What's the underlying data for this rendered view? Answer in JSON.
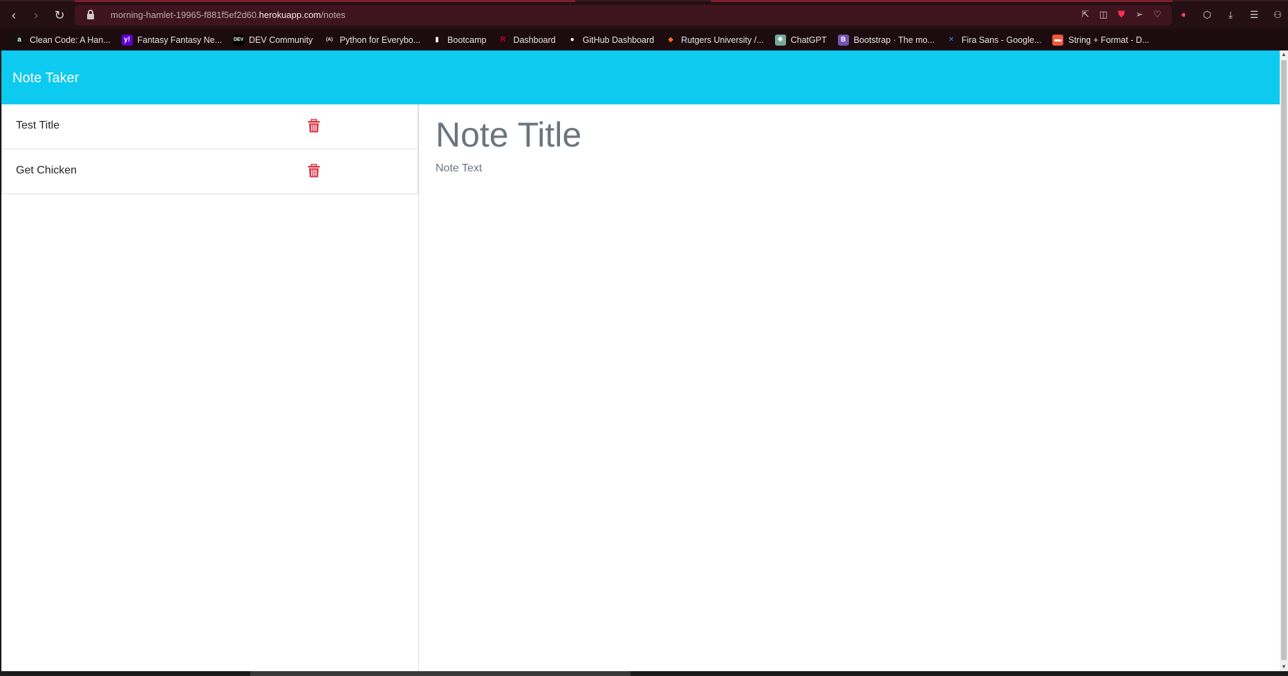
{
  "browser": {
    "url_prefix": "morning-hamlet-19965-f881f5ef2d60.",
    "url_host": "herokuapp.com",
    "url_path": "/notes",
    "nav": {
      "back": "‹",
      "forward": "›",
      "reload": "↻"
    }
  },
  "bookmarks": [
    {
      "label": "Clean Code: A Han...",
      "icon": "a",
      "icon_color": "#ffffff",
      "icon_bg": "#111111"
    },
    {
      "label": "Fantasy Fantasy Ne...",
      "icon": "y!",
      "icon_color": "#ffffff",
      "icon_bg": "#6001d2"
    },
    {
      "label": "DEV Community",
      "icon": "DEV",
      "icon_color": "#ffffff",
      "icon_bg": "#000000"
    },
    {
      "label": "Python for Everybo...",
      "icon": "(A)",
      "icon_color": "#e9e3e5",
      "icon_bg": "transparent"
    },
    {
      "label": "Bootcamp",
      "icon": "▮",
      "icon_color": "#ffffff",
      "icon_bg": "transparent"
    },
    {
      "label": "Dashboard",
      "icon": "R",
      "icon_color": "#cc0033",
      "icon_bg": "transparent"
    },
    {
      "label": "GitHub Dashboard",
      "icon": "●",
      "icon_color": "#ffffff",
      "icon_bg": "transparent"
    },
    {
      "label": "Rutgers University /...",
      "icon": "◆",
      "icon_color": "#fc6d26",
      "icon_bg": "transparent"
    },
    {
      "label": "ChatGPT",
      "icon": "✺",
      "icon_color": "#ffffff",
      "icon_bg": "#74aa9c"
    },
    {
      "label": "Bootstrap · The mo...",
      "icon": "B",
      "icon_color": "#ffffff",
      "icon_bg": "#7952b3"
    },
    {
      "label": "Fira Sans - Google...",
      "icon": "✕",
      "icon_color": "#4285f4",
      "icon_bg": "transparent"
    },
    {
      "label": "String + Format - D...",
      "icon": "▬",
      "icon_color": "#ffffff",
      "icon_bg": "#ee5a3c"
    }
  ],
  "app": {
    "brand": "Note Taker",
    "brand_bg": "#0dcaf0",
    "notes": [
      {
        "title": "Test Title"
      },
      {
        "title": "Get Chicken"
      }
    ],
    "delete_icon_color": "#dc3545",
    "editor": {
      "title_placeholder": "Note Title",
      "text_placeholder": "Note Text"
    }
  }
}
